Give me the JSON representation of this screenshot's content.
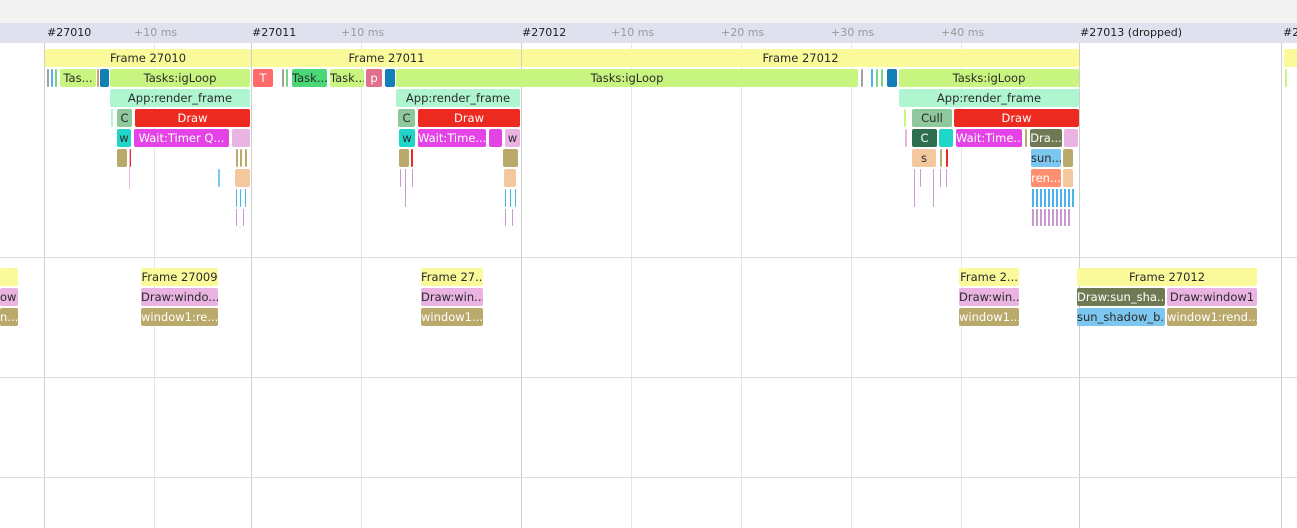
{
  "colors": {
    "frame": "#fafa9a",
    "taskloop": "#c8f57f",
    "render": "#aef5d0",
    "draw": "#ec2a1f",
    "wait": "#e444e6",
    "teal": "#1fd6c9",
    "dark_green": "#2d6e4e",
    "olive": "#b9a96b",
    "olive_dark": "#6f7a55",
    "pink": "#e9b3e2",
    "orange": "#ff8f6e",
    "blue": "#7cc7f0",
    "peach": "#f4c89e",
    "gray_green": "#8fc89c",
    "bright_green": "#4ad877",
    "salmon": "#ff6b6b",
    "rose": "#e1708a",
    "cyan_dark": "#137fb4"
  },
  "ruler": {
    "ticks": [
      {
        "label": "#27010",
        "major": true
      },
      {
        "label": "+10 ms",
        "major": false
      },
      {
        "label": "#27011",
        "major": true
      },
      {
        "label": "+10 ms",
        "major": false
      },
      {
        "label": "#27012",
        "major": true
      },
      {
        "label": "+10 ms",
        "major": false
      },
      {
        "label": "+20 ms",
        "major": false
      },
      {
        "label": "+30 ms",
        "major": false
      },
      {
        "label": "+40 ms",
        "major": false
      },
      {
        "label": "#27013 (dropped)",
        "major": true
      },
      {
        "label": "#2",
        "major": true
      }
    ]
  },
  "cpu_track": {
    "frames": [
      "Frame 27010",
      "Frame 27011",
      "Frame 27012"
    ],
    "tasks": [
      "Tas...",
      "Tasks:igLoop",
      "T",
      "Task...",
      "Task...",
      "p",
      "Tasks:igLoop",
      "Tasks:igLoop"
    ],
    "render": [
      "App:render_frame",
      "App:render_frame",
      "App:render_frame"
    ],
    "draw": [
      "C",
      "Draw",
      "C",
      "Draw",
      "Cull",
      "Draw"
    ],
    "row4": [
      "w",
      "Wait:Timer Q...",
      "w",
      "Wait:Time...",
      "w",
      "C",
      "Wait:Time...",
      "Dra..."
    ],
    "row5": [
      "s",
      "sun..."
    ],
    "row6": [
      "ren..."
    ]
  },
  "gpu_track": {
    "frames": [
      "Frame 27009",
      "Frame 27...",
      "Frame 2...",
      "Frame 27012"
    ],
    "draws": [
      "Draw:windo...",
      "Draw:win...",
      "Draw:win...",
      "Draw:sun_sha...",
      "Draw:window1"
    ],
    "passes": [
      "window1:re...",
      "window1...",
      "window1...",
      "sun_shadow_b...",
      "window1:rend..."
    ],
    "left_edge": [
      "ow1",
      "n..."
    ]
  }
}
